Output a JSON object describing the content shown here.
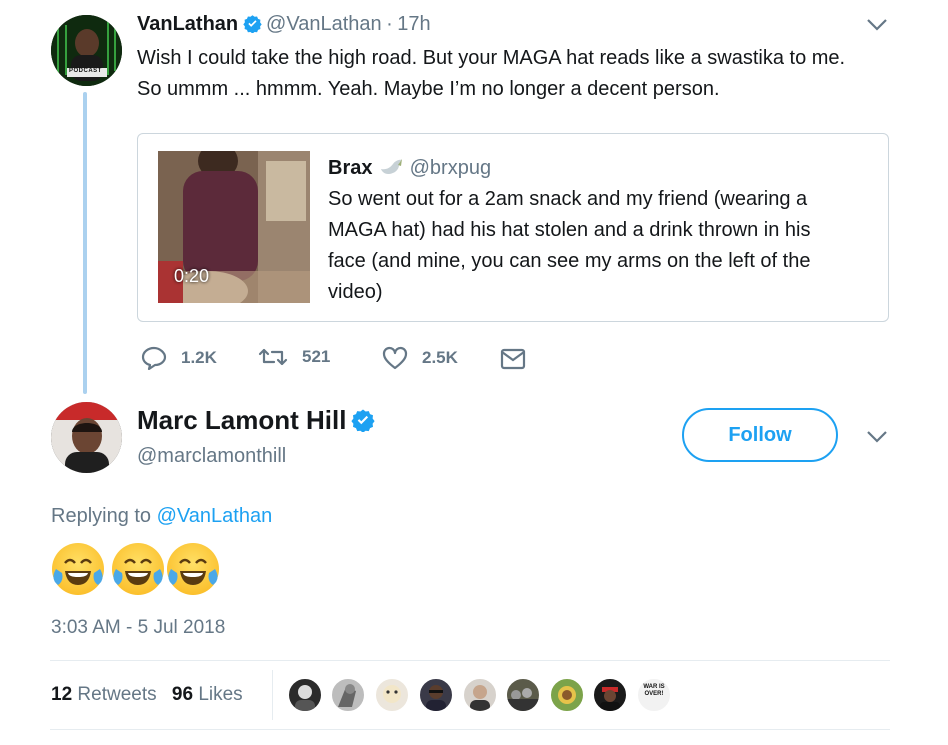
{
  "parent_tweet": {
    "name": "VanLathan",
    "handle": "@VanLathan",
    "separator": "·",
    "time": "17h",
    "text_line1": "Wish I could take the high road. But your MAGA hat reads like a swastika to me.",
    "text_line2": "So ummm ... hmmm. Yeah. Maybe I’m no longer a decent person.",
    "avatar_label": "PODCAST",
    "quoted": {
      "name": "Brax",
      "handle": "@brxpug",
      "video_duration": "0:20",
      "text_lines": [
        "So went out for a 2am snack and my friend (wearing a",
        "MAGA hat) had his hat stolen and a drink thrown in his",
        "face (and mine, you can see my arms on the left of the",
        "video)"
      ]
    },
    "actions": {
      "replies": "1.2K",
      "retweets": "521",
      "likes": "2.5K"
    }
  },
  "main_tweet": {
    "name": "Marc Lamont Hill",
    "handle": "@marclamonthill",
    "follow_label": "Follow",
    "replying_prefix": "Replying to",
    "replying_to": "@VanLathan",
    "emoji_count": 3,
    "timestamp": "3:03 AM - 5 Jul 2018",
    "retweet_count": "12",
    "retweet_label": "Retweets",
    "like_count": "96",
    "like_label": "Likes",
    "likers": [
      "liker-1",
      "liker-2",
      "liker-3",
      "liker-4",
      "liker-5",
      "liker-6",
      "liker-7",
      "liker-8",
      "liker-9"
    ],
    "liker_9_badge": "WAR IS OVER!"
  },
  "colors": {
    "accent": "#1da1f2",
    "muted": "#657786",
    "text": "#14171a",
    "thread_line": "#abd1ef",
    "border": "#ccd6dd"
  },
  "icons": [
    "verified-badge-icon",
    "chevron-down-icon",
    "reply-icon",
    "retweet-icon",
    "like-icon",
    "message-icon",
    "dove-icon",
    "crying-laughing-emoji-icon"
  ]
}
